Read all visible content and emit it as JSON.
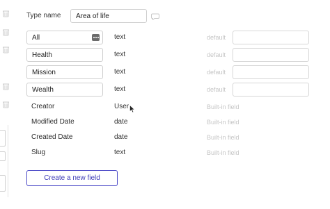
{
  "type_name": {
    "label": "Type name",
    "value": "Area of life"
  },
  "fields": [
    {
      "name": "All",
      "type": "text",
      "default_label": "default",
      "editable": true,
      "has_menu": true
    },
    {
      "name": "Health",
      "type": "text",
      "default_label": "default",
      "editable": true
    },
    {
      "name": "Mission",
      "type": "text",
      "default_label": "default",
      "editable": true
    },
    {
      "name": "Wealth",
      "type": "text",
      "default_label": "default",
      "editable": true
    },
    {
      "name": "Creator",
      "type": "User",
      "default_label": "Built-in field",
      "editable": false
    },
    {
      "name": "Modified Date",
      "type": "date",
      "default_label": "Built-in field",
      "editable": false
    },
    {
      "name": "Created Date",
      "type": "date",
      "default_label": "Built-in field",
      "editable": false
    },
    {
      "name": "Slug",
      "type": "text",
      "default_label": "Built-in field",
      "editable": false
    }
  ],
  "create_button_label": "Create a new field",
  "colors": {
    "accent": "#4a48c7",
    "muted": "#c6c6c6",
    "border": "#cfcfcf"
  },
  "icons": [
    "trash-icon",
    "comment-icon",
    "more-dots-icon",
    "mouse-cursor-icon"
  ]
}
